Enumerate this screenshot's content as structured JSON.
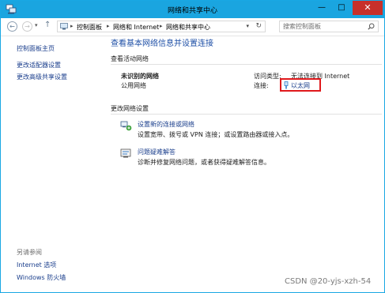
{
  "window": {
    "title": "网络和共享中心",
    "minimize": "—",
    "maximize": "□",
    "close": "✕"
  },
  "address": {
    "back": "←",
    "forward": "→",
    "dropdown": "▾",
    "up": "↑",
    "breadcrumb": [
      "控制面板",
      "网络和 Internet",
      "网络和共享中心"
    ],
    "separator": "▸",
    "refresh": "↻",
    "search_placeholder": "搜索控制面板"
  },
  "sidebar": {
    "items": [
      {
        "label": "控制面板主页"
      },
      {
        "label": "更改适配器设置"
      },
      {
        "label": "更改高级共享设置"
      }
    ],
    "see_also_title": "另请参阅",
    "see_also": [
      {
        "label": "Internet 选项"
      },
      {
        "label": "Windows 防火墙"
      }
    ]
  },
  "main": {
    "title": "查看基本网络信息并设置连接",
    "active_networks_heading": "查看活动网络",
    "network": {
      "name": "未识别的网络",
      "type": "公用网络",
      "access_type_label": "访问类型:",
      "access_type_value": "无法连接到 Internet",
      "connections_label": "连接:",
      "connection_name": "以太网"
    },
    "change_settings_heading": "更改网络设置",
    "tasks": [
      {
        "icon": "setup-connection-icon",
        "link": "设置新的连接或网络",
        "desc": "设置宽带、拨号或 VPN 连接；或设置路由器或接入点。"
      },
      {
        "icon": "troubleshoot-icon",
        "link": "问题疑难解答",
        "desc": "诊断并修复网络问题，或者获得疑难解答信息。"
      }
    ]
  },
  "watermark": "CSDN @20-yjs-xzh-54",
  "colors": {
    "titlebar": "#1aa5e0",
    "link": "#1a3e8c",
    "heading": "#1e4fa6",
    "highlight_box": "#e0191c",
    "close_button": "#c7302a"
  }
}
